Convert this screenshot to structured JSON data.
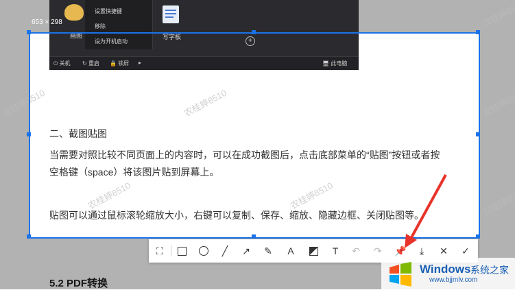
{
  "selection_size": "653 × 298",
  "watermark": "农桂婷8510",
  "launcher": {
    "context_menu": [
      "设置快捷键",
      "移除",
      "设为开机启动"
    ],
    "tile_left": "画图",
    "tile_right": "写字板",
    "footer": {
      "shutdown": "关机",
      "restart": "重启",
      "lock": "锁屏",
      "pc": "此电脑"
    }
  },
  "content": {
    "heading": "二、截图贴图",
    "para1_line1": "当需要对照比较不同页面上的内容时，可以在成功截图后，点击底部菜单的“贴图”按钮或者按",
    "para1_line2": "空格键（space）将该图片贴到屏幕上。",
    "para2": "贴图可以通过鼠标滚轮缩放大小，右键可以复制、保存、缩放、隐藏边框、关闭贴图等。"
  },
  "bottom_heading": "5.2 PDF转换",
  "brand": {
    "name": "Windows",
    "cn": "系统之家",
    "url": "www.bjjmlv.com"
  },
  "colors": {
    "selection": "#1a73e8",
    "arrow": "#e8332a"
  }
}
